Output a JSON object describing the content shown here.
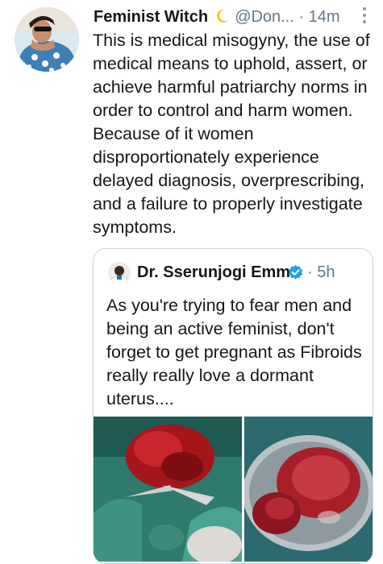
{
  "tweet": {
    "author_name": "Feminist Witch",
    "handle": "@Don...",
    "time": "· 14m",
    "text": "This is medical misogyny, the use of medical means to uphold, assert, or achieve  harmful patriarchy norms in order to control and harm women. Because of it women disproportionately experience delayed diagnosis, overprescribing, and a failure to properly investigate symptoms."
  },
  "quote": {
    "author_name": "Dr. Sserunjogi Emma",
    "time": "· 5h",
    "text": "As you're trying to fear men and being an active feminist, don't forget to get pregnant as Fibroids really really love a dormant uterus...."
  },
  "icons": {
    "moon": "crescent-moon-emoji",
    "verified": "verified-badge-icon",
    "more": "more-vertical-icon"
  },
  "colors": {
    "text": "#14171a",
    "secondary": "#657786",
    "verified": "#1da1f2",
    "border": "#ccd6dd"
  }
}
